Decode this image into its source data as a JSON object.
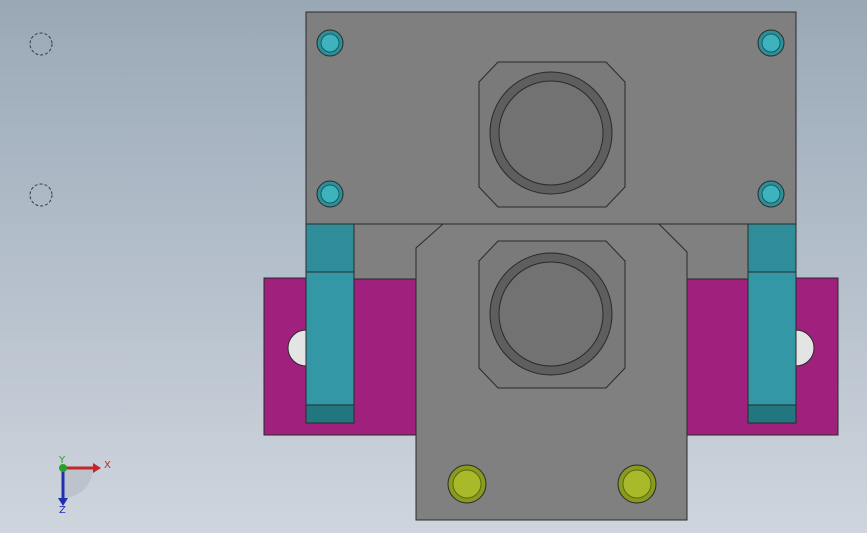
{
  "viewport": {
    "background_top": "#9aa8b6",
    "background_bottom": "#cfd5dd"
  },
  "colors": {
    "body_gray": "#7f7f7f",
    "bore_gray": "#6e6e6e",
    "clamp_magenta": "#a0207e",
    "arm_teal": "#3397a6",
    "arm_teal_dark": "#22767f",
    "bolt_teal": "#3fb3bd",
    "pin_olive": "#a8ba2a",
    "axis_x": "#c0282a",
    "axis_y": "#2aa02a",
    "axis_z": "#1f2fb0"
  },
  "sketch_points": [
    {
      "name": "sketch-point-1"
    },
    {
      "name": "sketch-point-2"
    }
  ],
  "triad": {
    "x_label": "X",
    "y_label": "Y",
    "z_label": "Z"
  }
}
